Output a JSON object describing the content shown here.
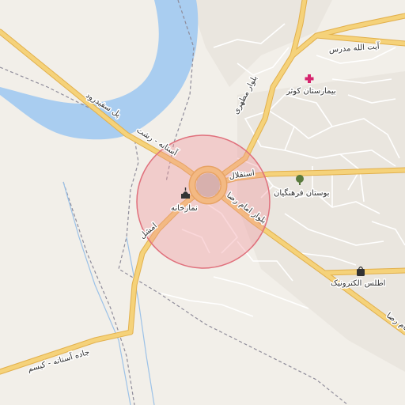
{
  "map": {
    "colors": {
      "land": "#f2efe9",
      "water": "#a9cdf0",
      "major_road": "#f5d27a",
      "major_road_casing": "#e2b04c",
      "minor_road": "#ffffff",
      "minor_road_casing": "#d8d2c8",
      "boundary": "#8f8c9a",
      "highlight_fill": "#f08c96",
      "highlight_stroke": "#e0707c",
      "hospital": "#d6246e",
      "park_icon": "#5a7a3c",
      "shop_icon": "#333333"
    },
    "roads": {
      "road_saeedrud": "پل سفیدرود",
      "road_astaneh_rasht": "آستانه - رشت",
      "road_esteghlal": "استقلال",
      "road_imam_reza": "بلوار امام رضا",
      "road_imam_reza_east": "امام رضا",
      "road_motahari": "بلوار مطهری",
      "road_ayatollah_modarres": "آیت الله مدرس",
      "road_astaneh_kisom": "جاده آستانه - کیسم",
      "road_amshal": "امشل"
    },
    "pois": {
      "poi_hospital": "بیمارستان کوثر",
      "poi_park": "بوستان فرهنگیان",
      "poi_mosque": "نمازخانه",
      "poi_shop": "اطلس الکترونیک"
    },
    "icons": {
      "hospital": "hospital-cross-icon",
      "park": "tree-icon",
      "mosque": "mosque-icon",
      "shop": "shopping-bag-icon"
    }
  }
}
